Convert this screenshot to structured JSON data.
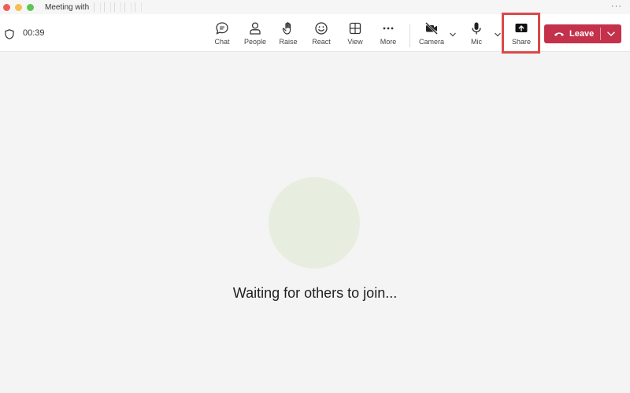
{
  "window": {
    "title": "Meeting with",
    "menu_glyph": "···"
  },
  "toolbar": {
    "timer": "00:39",
    "buttons": [
      {
        "id": "chat",
        "label": "Chat",
        "icon": "chat-bubble-icon"
      },
      {
        "id": "people",
        "label": "People",
        "icon": "person-icon"
      },
      {
        "id": "raise",
        "label": "Raise",
        "icon": "raised-hand-icon"
      },
      {
        "id": "react",
        "label": "React",
        "icon": "smiley-icon"
      },
      {
        "id": "view",
        "label": "View",
        "icon": "grid-view-icon"
      },
      {
        "id": "more",
        "label": "More",
        "icon": "ellipsis-icon"
      },
      {
        "id": "camera",
        "label": "Camera",
        "icon": "camera-off-icon"
      },
      {
        "id": "mic",
        "label": "Mic",
        "icon": "microphone-icon"
      },
      {
        "id": "share",
        "label": "Share",
        "icon": "share-screen-icon",
        "highlighted": true
      }
    ],
    "leave": {
      "label": "Leave",
      "color": "#c4314b"
    }
  },
  "stage": {
    "status": "Waiting for others to join...",
    "placeholder_color": "#e7eedf"
  },
  "highlight_color": "#d84a4a"
}
